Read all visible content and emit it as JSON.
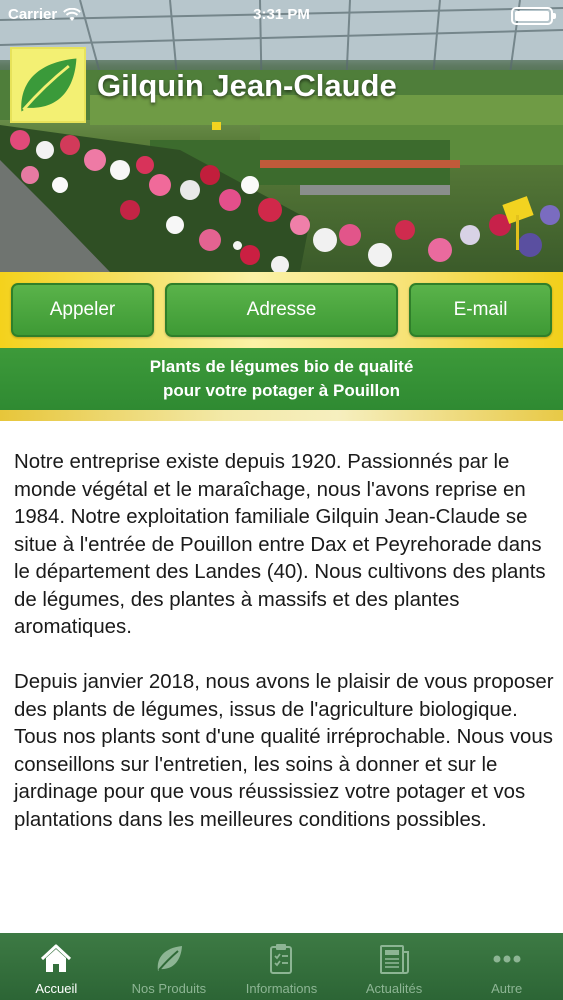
{
  "status_bar": {
    "carrier": "Carrier",
    "time": "3:31 PM",
    "battery_level": 1.0
  },
  "header": {
    "company_name": "Gilquin Jean-Claude",
    "logo_icon": "leaf-icon",
    "carousel": {
      "pages": 1,
      "current": 1
    }
  },
  "actions": {
    "call_label": "Appeler",
    "address_label": "Adresse",
    "email_label": "E-mail"
  },
  "tagline": {
    "line1": "Plants de légumes bio de qualité",
    "line2": "pour votre potager à Pouillon"
  },
  "content": {
    "paragraphs": [
      "Notre entreprise existe depuis 1920. Passionnés par le monde végétal et le maraîchage, nous l'avons reprise en 1984. Notre exploitation familiale Gilquin Jean-Claude se situe à l'entrée de Pouillon entre Dax et Peyrehorade dans le département des Landes (40). Nous cultivons des plants de légumes, des plantes à massifs et des plantes aromatiques.",
      "Depuis janvier 2018, nous avons le plaisir de vous proposer des plants de légumes, issus de l'agriculture biologique. Tous nos plants sont d'une qualité irréprochable. Nous vous conseillons sur l'entretien, les soins à donner et sur le jardinage pour que vous réussissiez votre potager et vos plantations dans les meilleures conditions possibles."
    ]
  },
  "tabs": [
    {
      "label": "Accueil",
      "icon": "home-icon",
      "active": true
    },
    {
      "label": "Nos Produits",
      "icon": "leaf-icon",
      "active": false
    },
    {
      "label": "Informations",
      "icon": "clipboard-icon",
      "active": false
    },
    {
      "label": "Actualités",
      "icon": "newspaper-icon",
      "active": false
    },
    {
      "label": "Autre",
      "icon": "more-icon",
      "active": false
    }
  ],
  "colors": {
    "primary_green": "#3e9a35",
    "tab_bar_green": "#2c6535",
    "accent_yellow": "#f4d21c"
  }
}
